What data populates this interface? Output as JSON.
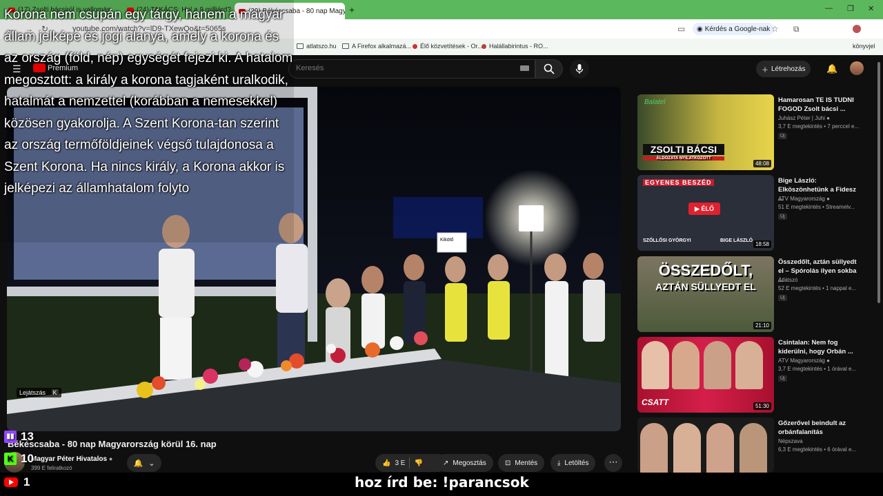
{
  "browser": {
    "tabs": [
      {
        "label": "(17) Zsolti bácsiról is vallomás"
      },
      {
        "label": "(24) TAKÁCS: Hol a 9 milliárd?"
      },
      {
        "label": "(29) Békéscsaba - 80 nap Magyar"
      }
    ],
    "url": "youtube.com/watch?v=lD9-TXewQo&t=5065s",
    "google_chip": "Kérdés a Google-nak",
    "bookmarks": [
      {
        "label": "atlatszo.hu",
        "icon": "folder-icon"
      },
      {
        "label": "A Firefox alkalmazá...",
        "icon": "folder-icon"
      },
      {
        "label": "Élő közvetítések - Or...",
        "icon": "dot-icon"
      },
      {
        "label": "Halállabirintus - RO...",
        "icon": "dot-icon"
      }
    ],
    "bookmarks_right": "könyvjel"
  },
  "youtube": {
    "logo_text": "Premium",
    "search_placeholder": "Keresés",
    "create_label": "Létrehozás"
  },
  "video": {
    "title": "Békéscsaba - 80 nap Magyarország körül 16. nap",
    "playing_label": "Lejátszás",
    "playing_key": "K",
    "stage_sign": "Kikötő",
    "channel_name": "Magyar Péter Hivatalos",
    "subscribers": "399 E feliratkozó",
    "likes": "3 E",
    "share_label": "Megosztás",
    "save_label": "Mentés",
    "download_label": "Letöltés"
  },
  "recommendations": [
    {
      "title": "Hamarosan TE IS TUDNI FOGOD Zsolt bácsi ...",
      "channel": "Juhász Péter | Juhi",
      "meta": "3,7 E megtekintés • 7 perccel e...",
      "badge": "Új",
      "duration": "48:08",
      "thumb_text": "ZSOLTI BÁCSI",
      "thumb_sub": "ÁLDOZATA NYILATKOZOTT",
      "thumb_corner": "Balatel",
      "bg": "#e8d44a"
    },
    {
      "title": "Bige László: Elköszönhetünk a Fidesz ...",
      "channel": "ATV Magyarország",
      "meta": "51 E megtekintés • Streamelv...",
      "badge": "Új",
      "duration": "18:58",
      "thumb_text": "ÉLŐ",
      "thumb_sub": "SZŐLLŐSI GYÖRGYI",
      "thumb_sub2": "BIGE LÁSZLÓ",
      "thumb_corner": "EGYENES BESZÉD",
      "bg": "#2a2f3a"
    },
    {
      "title": "Összedőlt, aztán süllyedt el – Spórolás ilyen sokba ...",
      "channel": "Átlátszó",
      "meta": "52 E megtekintés • 1 nappal e...",
      "badge": "Új",
      "duration": "21:10",
      "thumb_text": "ÖSSZEDŐLT,",
      "thumb_sub": "AZTÁN SÜLLYEDT EL",
      "bg": "#6b6b4a"
    },
    {
      "title": "Csintalan: Nem fog kiderülni, hogy Orbán ...",
      "channel": "ATV Magyarország",
      "meta": "3,7 E megtekintés • 1 órával e...",
      "badge": "Új",
      "duration": "51:30",
      "thumb_text": "CSATT",
      "bg": "#b8123a"
    },
    {
      "title": "Gőzerővel beindult az orbánfalanítás",
      "channel": "Népszava",
      "meta": "6,3 E megtekintés • 6 órával e...",
      "badge": "",
      "duration": "",
      "thumb_text": "",
      "bg": "#1a1a1a"
    }
  ],
  "overlay": {
    "subtitle": "Korona nem csupán egy tárgy, hanem a magyar állam jelképe és jogi alanya, amely a korona és az ország (föld, nép) egységét fejezi ki. A hatalom megosztott: a király a korona tagjaként uralkodik, hatalmát a nemzettel (korábban a nemesekkel) közösen gyakorolja. A Szent Korona-tan szerint az ország termőföldjeinek végső tulajdonosa a Szent Korona. Ha nincs király, a Korona akkor is jelképezi az államhatalom folyto",
    "twitch_count": "13",
    "kick_count": "10",
    "youtube_count": "1",
    "ticker": "hoz írd be: !parancsok"
  },
  "colors": {
    "twitch": "#9146ff",
    "kick": "#53fc18",
    "youtube_red": "#ff0000",
    "tab_green": "#5cb85c"
  }
}
